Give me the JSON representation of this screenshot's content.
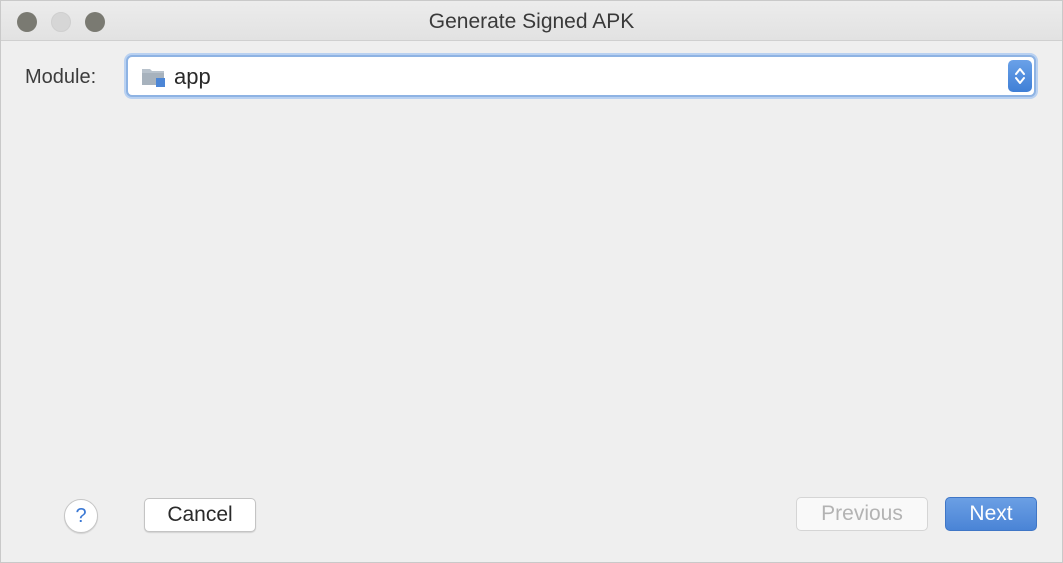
{
  "window": {
    "title": "Generate Signed APK",
    "traffic_lights": [
      "close",
      "minimize",
      "maximize"
    ]
  },
  "module": {
    "label": "Module:",
    "selected": "app",
    "icon": "folder-module-icon"
  },
  "footer": {
    "help_label": "?",
    "cancel_label": "Cancel",
    "previous_label": "Previous",
    "next_label": "Next"
  },
  "colors": {
    "accent": "#4a84d6",
    "focus_ring": "#8eb3e3",
    "disabled_text": "#b3b3b3"
  }
}
